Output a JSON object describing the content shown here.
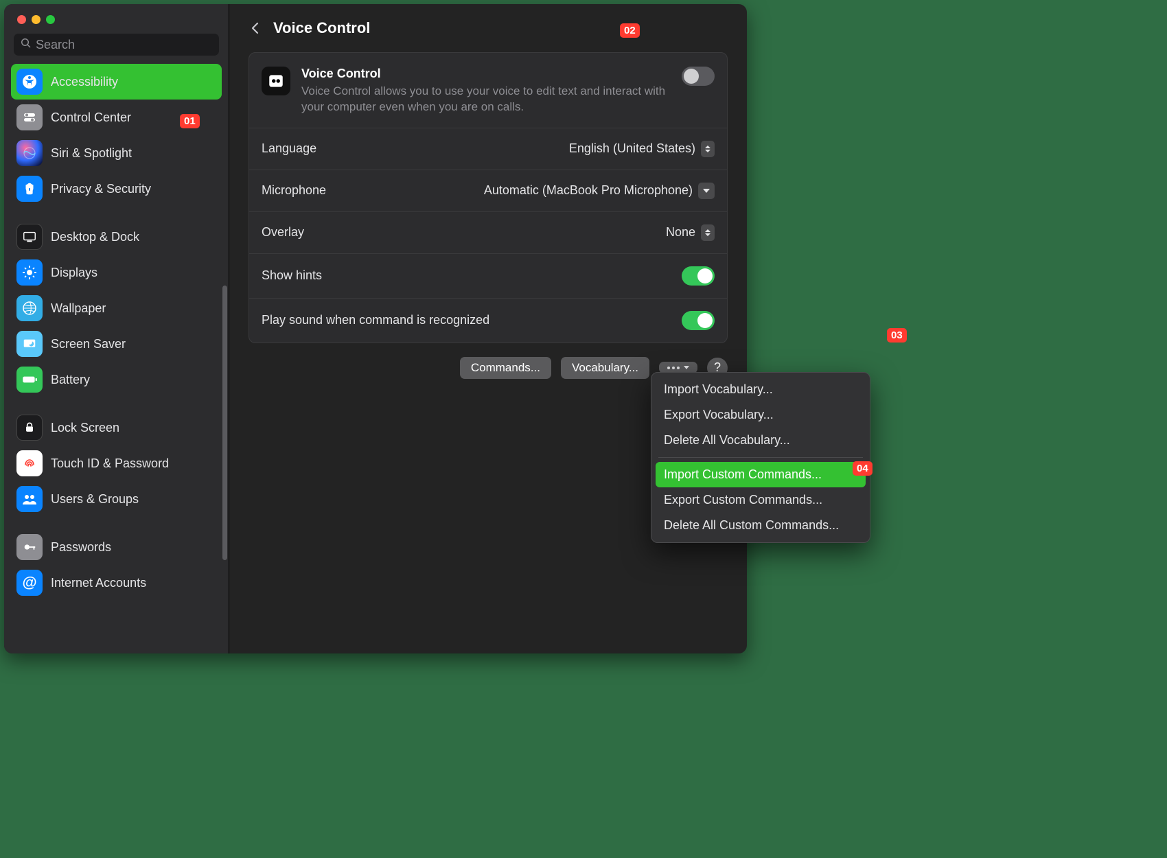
{
  "window": {
    "search_placeholder": "Search"
  },
  "sidebar": {
    "groups": [
      [
        {
          "label": "Accessibility",
          "icon": "accessibility",
          "selected": true
        },
        {
          "label": "Control Center",
          "icon": "controlcenter"
        },
        {
          "label": "Siri & Spotlight",
          "icon": "siri"
        },
        {
          "label": "Privacy & Security",
          "icon": "privacy"
        }
      ],
      [
        {
          "label": "Desktop & Dock",
          "icon": "desktop"
        },
        {
          "label": "Displays",
          "icon": "displays"
        },
        {
          "label": "Wallpaper",
          "icon": "wallpaper"
        },
        {
          "label": "Screen Saver",
          "icon": "screensaver"
        },
        {
          "label": "Battery",
          "icon": "battery"
        }
      ],
      [
        {
          "label": "Lock Screen",
          "icon": "lockscreen"
        },
        {
          "label": "Touch ID & Password",
          "icon": "touchid"
        },
        {
          "label": "Users & Groups",
          "icon": "users"
        }
      ],
      [
        {
          "label": "Passwords",
          "icon": "passwords"
        },
        {
          "label": "Internet Accounts",
          "icon": "internet"
        }
      ]
    ]
  },
  "header": {
    "title": "Voice Control"
  },
  "vc": {
    "title": "Voice Control",
    "desc": "Voice Control allows you to use your voice to edit text and interact with your computer even when you are on calls.",
    "enabled": false
  },
  "rows": {
    "language_label": "Language",
    "language_value": "English (United States)",
    "microphone_label": "Microphone",
    "microphone_value": "Automatic (MacBook Pro Microphone)",
    "overlay_label": "Overlay",
    "overlay_value": "None",
    "hints_label": "Show hints",
    "sound_label": "Play sound when command is recognized"
  },
  "footer": {
    "commands": "Commands...",
    "vocab": "Vocabulary...",
    "help": "?"
  },
  "dropdown": {
    "g1": [
      "Import Vocabulary...",
      "Export Vocabulary...",
      "Delete All Vocabulary..."
    ],
    "g2": [
      "Import Custom Commands...",
      "Export Custom Commands...",
      "Delete All Custom Commands..."
    ],
    "highlight_index": 0
  },
  "badges": {
    "b01": "01",
    "b02": "02",
    "b03": "03",
    "b04": "04"
  }
}
